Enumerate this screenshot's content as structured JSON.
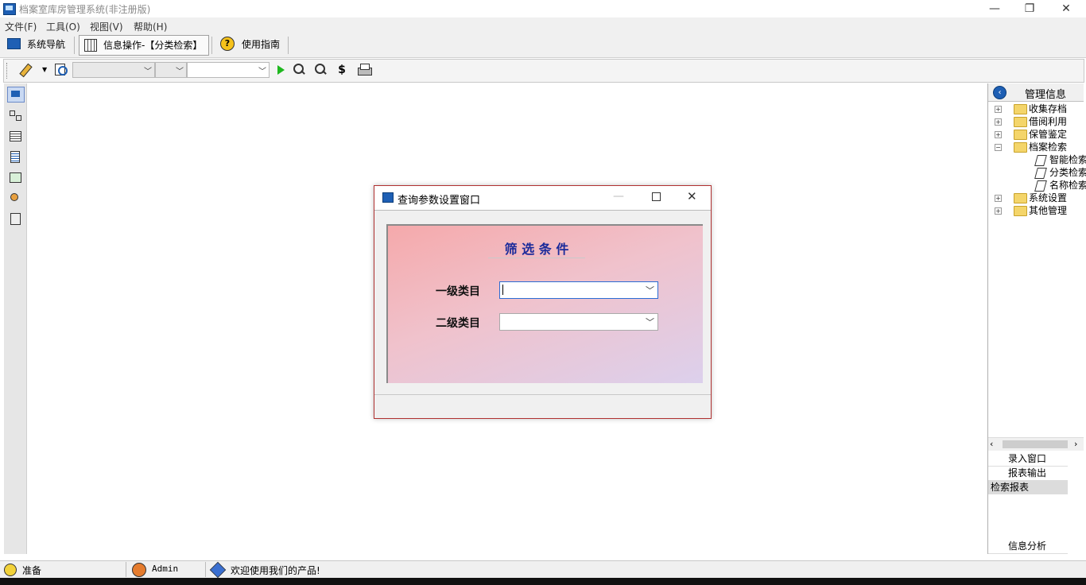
{
  "window": {
    "title": "档案室库房管理系统(非注册版)"
  },
  "menu": [
    "文件(F)",
    "工具(O)",
    "视图(V)",
    "帮助(H)"
  ],
  "navbar": {
    "nav": "系统导航",
    "info": "信息操作-【分类检索】",
    "guide": "使用指南"
  },
  "right_panel": {
    "header": "管理信息",
    "tree": [
      "收集存档",
      "借阅利用",
      "保管鉴定",
      "档案检索",
      "智能检索",
      "分类检索",
      "名称检索",
      "系统设置",
      "其他管理"
    ],
    "links": [
      "录入窗口",
      "报表输出",
      "检索报表"
    ],
    "bottom_link": "信息分析"
  },
  "status": {
    "state": "准备",
    "user": "Admin",
    "welcome": "欢迎使用我们的产品!"
  },
  "dialog": {
    "title": "查询参数设置窗口",
    "heading": "筛 选 条 件",
    "label1": "一级类目",
    "label2": "二级类目",
    "value1": "",
    "value2": ""
  },
  "colors": {
    "accent": "#1e5fb4",
    "dialog_border": "#b03030",
    "heading": "#1a2a9a"
  }
}
